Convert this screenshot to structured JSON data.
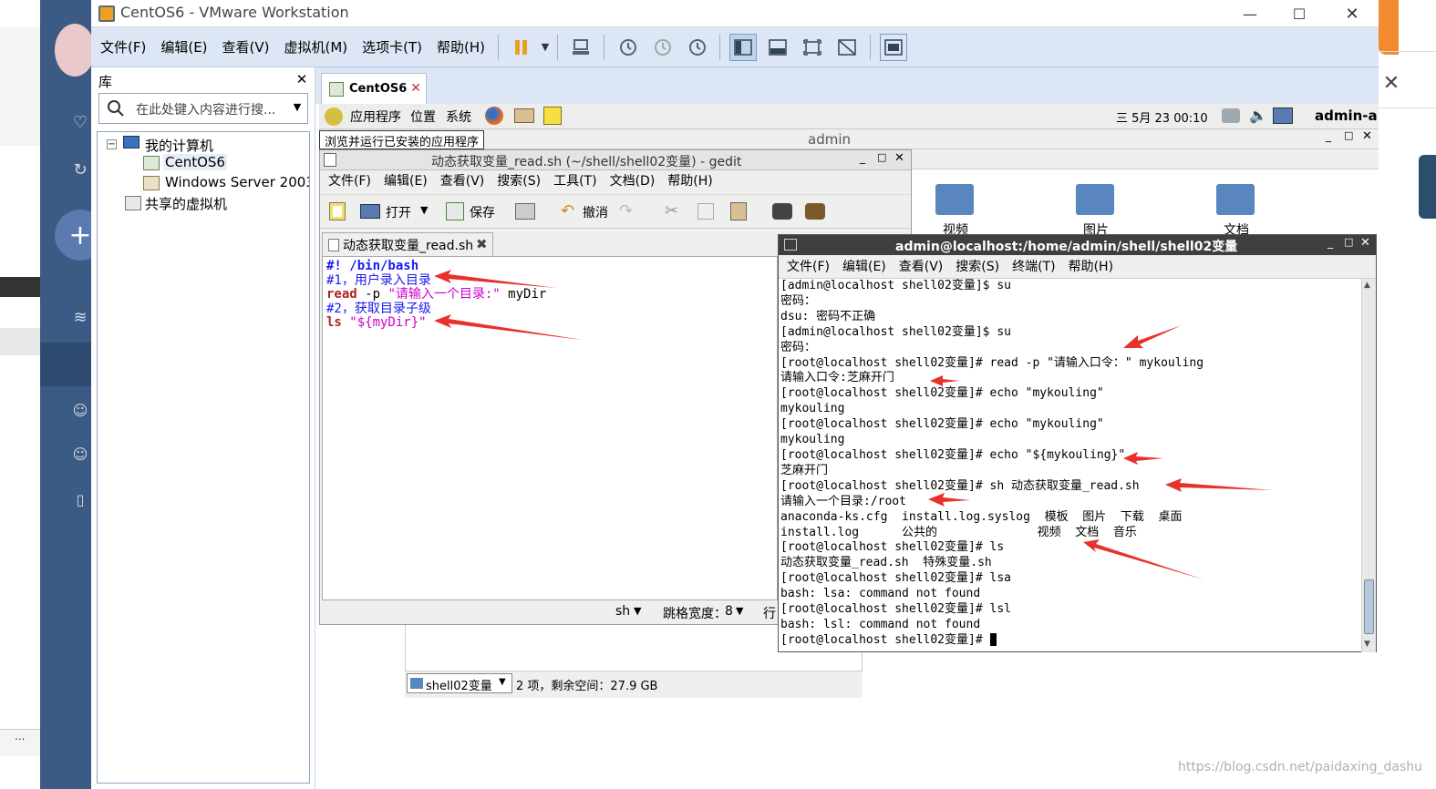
{
  "window": {
    "title": "CentOS6 - VMware Workstation"
  },
  "menubar": {
    "items": [
      "文件(F)",
      "编辑(E)",
      "查看(V)",
      "虚拟机(M)",
      "选项卡(T)",
      "帮助(H)"
    ]
  },
  "library": {
    "title": "库",
    "search_placeholder": "在此处键入内容进行搜...",
    "tree": {
      "my_computer": "我的计算机",
      "vm1": "CentOS6",
      "vm2": "Windows Server 2003",
      "shared": "共享的虚拟机"
    }
  },
  "vm_tab": {
    "label": "CentOS6"
  },
  "gnome": {
    "applications": "应用程序",
    "places": "位置",
    "system": "系统",
    "clock": "三 5月 23 00:10",
    "user": "admin-a",
    "tooltip": "浏览并运行已安装的应用程序",
    "desktop_window_title": "admin"
  },
  "gedit": {
    "title": "动态获取变量_read.sh (~/shell/shell02变量) - gedit",
    "menu": [
      "文件(F)",
      "编辑(E)",
      "查看(V)",
      "搜索(S)",
      "工具(T)",
      "文档(D)",
      "帮助(H)"
    ],
    "toolbar": {
      "open": "打开",
      "save": "保存",
      "undo": "撤消"
    },
    "tab": "动态获取变量_read.sh",
    "code": {
      "l1": "#! /bin/bash",
      "l2": "#1，用户录入目录",
      "l3_kw": "read",
      "l3_opt": " -p ",
      "l3_str": "\"请输入一个目录:\"",
      "l3_var": " myDir",
      "l4": "#2，获取目录子级",
      "l5_kw": "ls",
      "l5_str": " \"${myDir}\""
    },
    "status": {
      "lang": "sh",
      "tab_width_label": "跳格宽度：",
      "tab_width": "8",
      "line": "行"
    }
  },
  "nautilus": {
    "icons": [
      "视频",
      "图片",
      "文档"
    ],
    "location": "shell02变量",
    "status": "2 项，剩余空间：27.9 GB"
  },
  "terminal": {
    "title": "admin@localhost:/home/admin/shell/shell02变量",
    "menu": [
      "文件(F)",
      "编辑(E)",
      "查看(V)",
      "搜索(S)",
      "终端(T)",
      "帮助(H)"
    ],
    "lines": [
      "[admin@localhost shell02变量]$ su",
      "密码：",
      "dsu: 密码不正确",
      "[admin@localhost shell02变量]$ su",
      "密码：",
      "[root@localhost shell02变量]# read -p \"请输入口令：\" mykouling",
      "请输入口令:芝麻开门",
      "[root@localhost shell02变量]# echo \"mykouling\"",
      "mykouling",
      "[root@localhost shell02变量]# echo \"mykouling\"",
      "mykouling",
      "[root@localhost shell02变量]# echo \"${mykouling}\"",
      "芝麻开门",
      "[root@localhost shell02变量]# sh 动态获取变量_read.sh",
      "请输入一个目录:/root",
      "anaconda-ks.cfg  install.log.syslog  模板  图片  下载  桌面",
      "install.log      公共的              视频  文档  音乐",
      "[root@localhost shell02变量]# ls",
      "动态获取变量_read.sh  特殊变量.sh",
      "[root@localhost shell02变量]# lsa",
      "bash: lsa: command not found",
      "[root@localhost shell02变量]# lsl",
      "bash: lsl: command not found",
      "[root@localhost shell02变量]# "
    ]
  },
  "watermark": "https://blog.csdn.net/paidaxing_dashu",
  "colors": {
    "menubar": "#dce6f4",
    "nav": "#3b5a84",
    "arrow": "#e8312a",
    "code_blue": "#1a1af0",
    "code_red": "#b22222",
    "code_magenta": "#cc00cc"
  }
}
